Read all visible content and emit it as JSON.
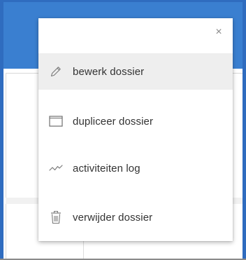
{
  "colors": {
    "header_blue": "#3a7fd0",
    "active_row": "#eeeeee",
    "text": "#333333",
    "icon": "#7a7a7a"
  },
  "menu": {
    "close_symbol": "×",
    "items": [
      {
        "label": "bewerk dossier",
        "icon": "pencil-icon",
        "active": true
      },
      {
        "label": "dupliceer dossier",
        "icon": "window-icon",
        "active": false
      },
      {
        "label": "activiteiten log",
        "icon": "activity-line-icon",
        "active": false
      },
      {
        "label": "verwijder dossier",
        "icon": "trash-icon",
        "active": false
      }
    ]
  }
}
